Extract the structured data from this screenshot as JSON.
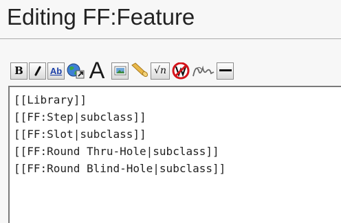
{
  "page": {
    "title": "Editing FF:Feature"
  },
  "toolbar": {
    "buttons": [
      {
        "name": "bold-button",
        "icon": "bold-icon",
        "glyph": "B"
      },
      {
        "name": "italic-button",
        "icon": "italic-icon",
        "glyph": "/"
      },
      {
        "name": "internal-link-button",
        "icon": "internal-link-icon",
        "glyph": "Ab"
      },
      {
        "name": "external-link-button",
        "icon": "globe-link-icon"
      },
      {
        "name": "headline-button",
        "icon": "headline-icon",
        "glyph": "A"
      },
      {
        "name": "embedded-image-button",
        "icon": "image-icon"
      },
      {
        "name": "media-file-button",
        "icon": "media-horn-icon"
      },
      {
        "name": "math-formula-button",
        "icon": "sqrt-icon",
        "glyph": "√n"
      },
      {
        "name": "nowiki-button",
        "icon": "no-wiki-icon"
      },
      {
        "name": "signature-button",
        "icon": "signature-icon"
      },
      {
        "name": "horizontal-line-button",
        "icon": "horizontal-line-icon"
      }
    ]
  },
  "editor": {
    "lines": [
      "[[Library]]",
      "[[FF:Step|subclass]]",
      "[[FF:Slot|subclass]]",
      "[[FF:Round Thru-Hole|subclass]]",
      "[[FF:Round Blind-Hole|subclass]]"
    ]
  },
  "colors": {
    "accent_link": "#1a3ea8",
    "no_red": "#d4141b"
  }
}
